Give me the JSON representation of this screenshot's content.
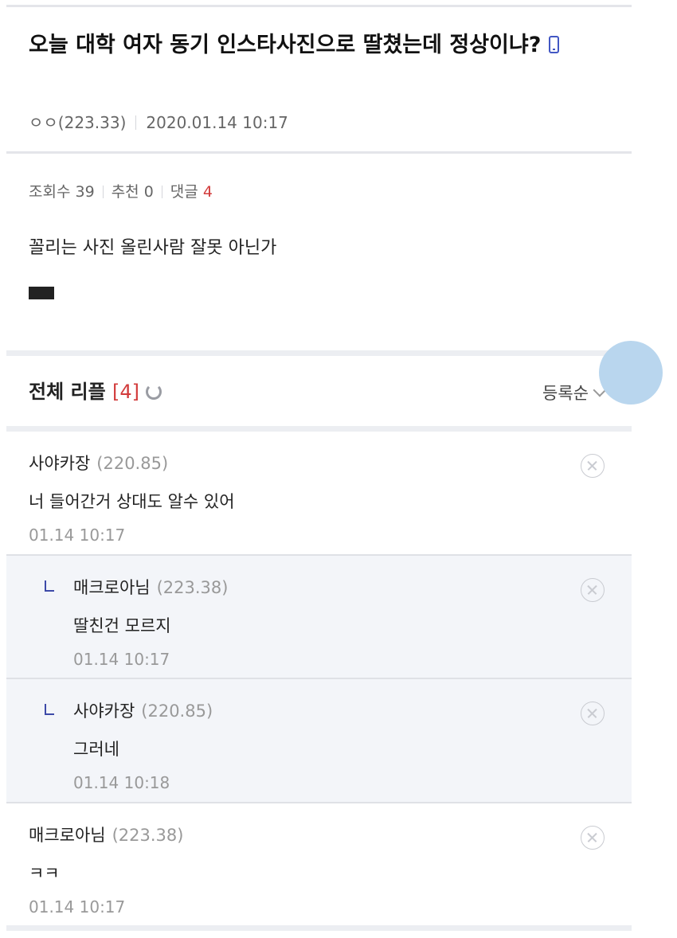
{
  "post": {
    "title": "오늘 대학 여자 동기 인스타사진으로 딸쳤는데 정상이냐?",
    "author": "ㅇㅇ(223.33)",
    "date": "2020.01.14 10:17",
    "views_label": "조회수",
    "views": "39",
    "recommend_label": "추천",
    "recommend": "0",
    "comments_label": "댓글",
    "comments": "4",
    "body": "꼴리는 사진 올린사람 잘못 아닌가"
  },
  "comments_section": {
    "title": "전체 리플",
    "count": "[4]",
    "sort_label": "등록순"
  },
  "comments": [
    {
      "author": "사야카장",
      "ip": "(220.85)",
      "text": "너 들어간거 상대도 알수 있어",
      "time": "01.14 10:17",
      "reply": false
    },
    {
      "author": "매크로아님",
      "ip": "(223.38)",
      "text": "딸친건 모르지",
      "time": "01.14 10:17",
      "reply": true
    },
    {
      "author": "사야카장",
      "ip": "(220.85)",
      "text": "그러네",
      "time": "01.14 10:18",
      "reply": true
    },
    {
      "author": "매크로아님",
      "ip": "(223.38)",
      "text": "ㅋㅋ",
      "time": "01.14 10:17",
      "reply": false
    }
  ]
}
